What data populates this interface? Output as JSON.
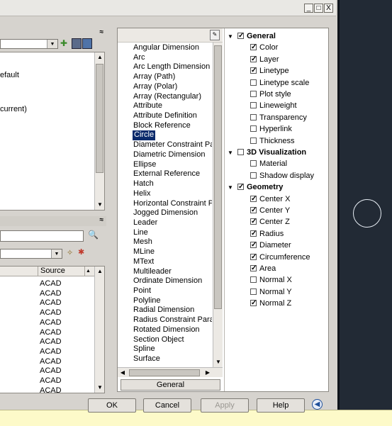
{
  "window": {
    "minimize": "_",
    "maximize": "□",
    "close": "X"
  },
  "left_panel": {
    "collapse_glyph": "≈",
    "list_items": [
      "efault",
      "current)"
    ],
    "table_header_source": "Source",
    "source_values": [
      "ACAD",
      "ACAD",
      "ACAD",
      "ACAD",
      "ACAD",
      "ACAD",
      "ACAD",
      "ACAD",
      "ACAD",
      "ACAD",
      "ACAD",
      "ACAD"
    ]
  },
  "object_types": [
    "Angular Dimension",
    "Arc",
    "Arc Length Dimension",
    "Array (Path)",
    "Array (Polar)",
    "Array (Rectangular)",
    "Attribute",
    "Attribute Definition",
    "Block Reference",
    "Circle",
    "Diameter Constraint Parame",
    "Diametric Dimension",
    "Ellipse",
    "External Reference",
    "Hatch",
    "Helix",
    "Horizontal Constraint Paran",
    "Jogged Dimension",
    "Leader",
    "Line",
    "Mesh",
    "MLine",
    "MText",
    "Multileader",
    "Ordinate Dimension",
    "Point",
    "Polyline",
    "Radial Dimension",
    "Radius Constraint Paramete",
    "Rotated Dimension",
    "Section Object",
    "Spline",
    "Surface"
  ],
  "selected_object": "Circle",
  "object_list_tab": "General",
  "properties": [
    {
      "label": "General",
      "level": 0,
      "bold": true,
      "expanded": true,
      "checked": true
    },
    {
      "label": "Color",
      "level": 1,
      "checked": true
    },
    {
      "label": "Layer",
      "level": 1,
      "checked": true
    },
    {
      "label": "Linetype",
      "level": 1,
      "checked": true
    },
    {
      "label": "Linetype scale",
      "level": 1,
      "checked": false
    },
    {
      "label": "Plot style",
      "level": 1,
      "checked": false
    },
    {
      "label": "Lineweight",
      "level": 1,
      "checked": false
    },
    {
      "label": "Transparency",
      "level": 1,
      "checked": false
    },
    {
      "label": "Hyperlink",
      "level": 1,
      "checked": false
    },
    {
      "label": "Thickness",
      "level": 1,
      "checked": false
    },
    {
      "label": "3D Visualization",
      "level": 0,
      "bold": true,
      "expanded": true,
      "checked": false
    },
    {
      "label": "Material",
      "level": 1,
      "checked": false
    },
    {
      "label": "Shadow display",
      "level": 1,
      "checked": false
    },
    {
      "label": "Geometry",
      "level": 0,
      "bold": true,
      "expanded": true,
      "checked": true
    },
    {
      "label": "Center X",
      "level": 1,
      "checked": true
    },
    {
      "label": "Center Y",
      "level": 1,
      "checked": true
    },
    {
      "label": "Center Z",
      "level": 1,
      "checked": true
    },
    {
      "label": "Radius",
      "level": 1,
      "checked": true
    },
    {
      "label": "Diameter",
      "level": 1,
      "checked": true
    },
    {
      "label": "Circumference",
      "level": 1,
      "checked": true
    },
    {
      "label": "Area",
      "level": 1,
      "checked": true
    },
    {
      "label": "Normal X",
      "level": 1,
      "checked": false
    },
    {
      "label": "Normal Y",
      "level": 1,
      "checked": false
    },
    {
      "label": "Normal Z",
      "level": 1,
      "checked": true
    }
  ],
  "buttons": {
    "ok": "OK",
    "cancel": "Cancel",
    "apply": "Apply",
    "help": "Help"
  }
}
